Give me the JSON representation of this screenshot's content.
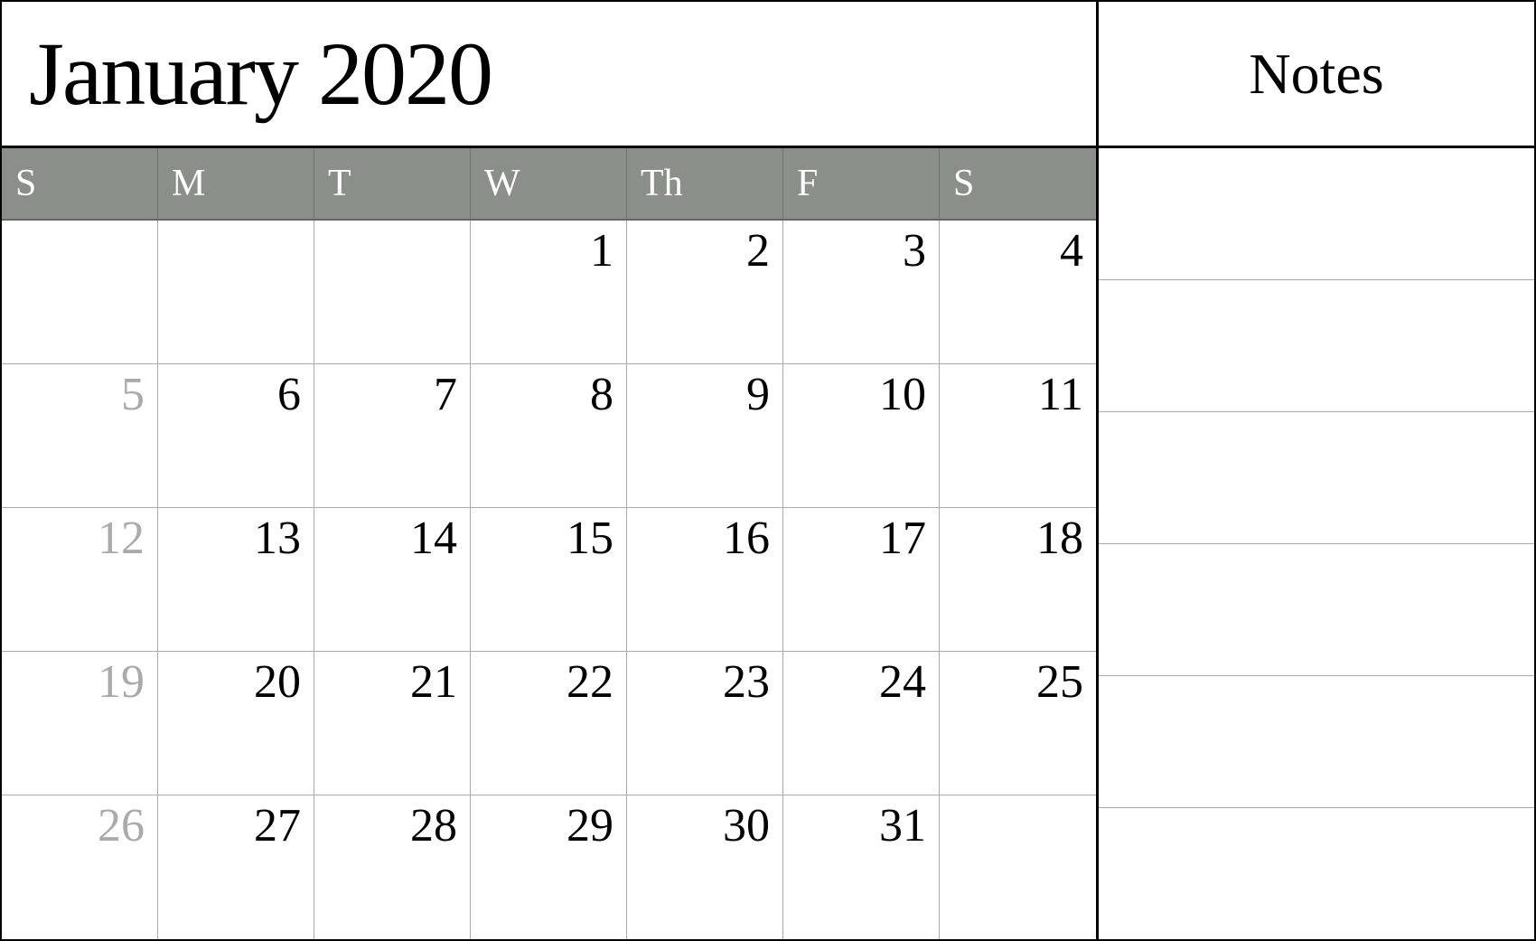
{
  "header": {
    "title": "January 2020",
    "notes_label": "Notes"
  },
  "days": [
    {
      "label": "S"
    },
    {
      "label": "M"
    },
    {
      "label": "T"
    },
    {
      "label": "W"
    },
    {
      "label": "Th"
    },
    {
      "label": "F"
    },
    {
      "label": "S"
    }
  ],
  "weeks": [
    [
      {
        "number": "",
        "muted": false,
        "empty": true
      },
      {
        "number": "",
        "muted": false,
        "empty": true
      },
      {
        "number": "",
        "muted": false,
        "empty": true
      },
      {
        "number": "1",
        "muted": false,
        "empty": false
      },
      {
        "number": "2",
        "muted": false,
        "empty": false
      },
      {
        "number": "3",
        "muted": false,
        "empty": false
      },
      {
        "number": "4",
        "muted": false,
        "empty": false
      }
    ],
    [
      {
        "number": "5",
        "muted": true,
        "empty": false
      },
      {
        "number": "6",
        "muted": false,
        "empty": false
      },
      {
        "number": "7",
        "muted": false,
        "empty": false
      },
      {
        "number": "8",
        "muted": false,
        "empty": false
      },
      {
        "number": "9",
        "muted": false,
        "empty": false
      },
      {
        "number": "10",
        "muted": false,
        "empty": false
      },
      {
        "number": "11",
        "muted": false,
        "empty": false
      }
    ],
    [
      {
        "number": "12",
        "muted": true,
        "empty": false
      },
      {
        "number": "13",
        "muted": false,
        "empty": false
      },
      {
        "number": "14",
        "muted": false,
        "empty": false
      },
      {
        "number": "15",
        "muted": false,
        "empty": false
      },
      {
        "number": "16",
        "muted": false,
        "empty": false
      },
      {
        "number": "17",
        "muted": false,
        "empty": false
      },
      {
        "number": "18",
        "muted": false,
        "empty": false
      }
    ],
    [
      {
        "number": "19",
        "muted": true,
        "empty": false
      },
      {
        "number": "20",
        "muted": false,
        "empty": false
      },
      {
        "number": "21",
        "muted": false,
        "empty": false
      },
      {
        "number": "22",
        "muted": false,
        "empty": false
      },
      {
        "number": "23",
        "muted": false,
        "empty": false
      },
      {
        "number": "24",
        "muted": false,
        "empty": false
      },
      {
        "number": "25",
        "muted": false,
        "empty": false
      }
    ],
    [
      {
        "number": "26",
        "muted": true,
        "empty": false
      },
      {
        "number": "27",
        "muted": false,
        "empty": false
      },
      {
        "number": "28",
        "muted": false,
        "empty": false
      },
      {
        "number": "29",
        "muted": false,
        "empty": false
      },
      {
        "number": "30",
        "muted": false,
        "empty": false
      },
      {
        "number": "31",
        "muted": false,
        "empty": false
      },
      {
        "number": "",
        "muted": false,
        "empty": true
      }
    ]
  ],
  "notes_rows": 6
}
